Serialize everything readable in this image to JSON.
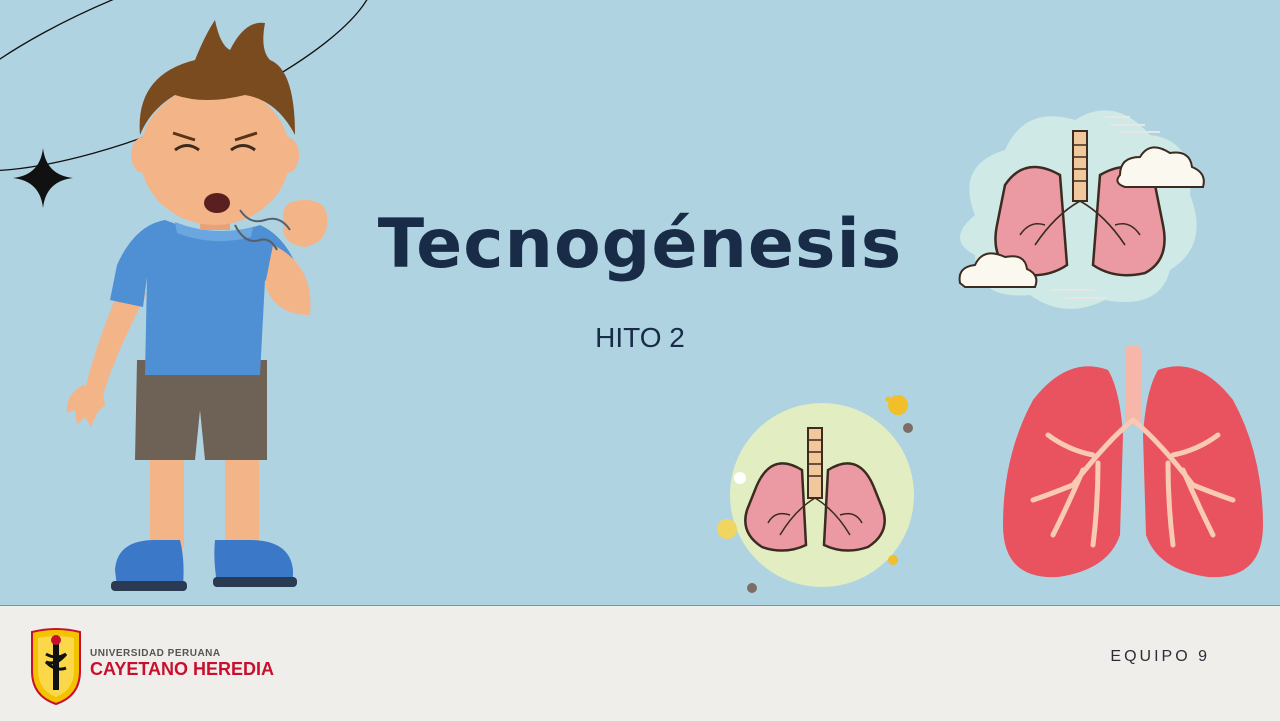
{
  "slide": {
    "title": "Tecnogénesis",
    "subtitle": "HITO 2"
  },
  "footer": {
    "logo": {
      "line1": "UNIVERSIDAD PERUANA",
      "line2": "CAYETANO HEREDIA"
    },
    "team": "EQUIPO 9"
  },
  "colors": {
    "background": "#b0d3e2",
    "footer": "#f0eeeb",
    "title": "#182b47",
    "brand_red": "#c8102e",
    "brand_gold": "#f3c300"
  },
  "icons": [
    "sparkle-icon",
    "orbit-line",
    "coughing-boy",
    "lungs-cloud-illustration",
    "lungs-circle-illustration",
    "lungs-red-illustration",
    "university-shield-logo"
  ]
}
